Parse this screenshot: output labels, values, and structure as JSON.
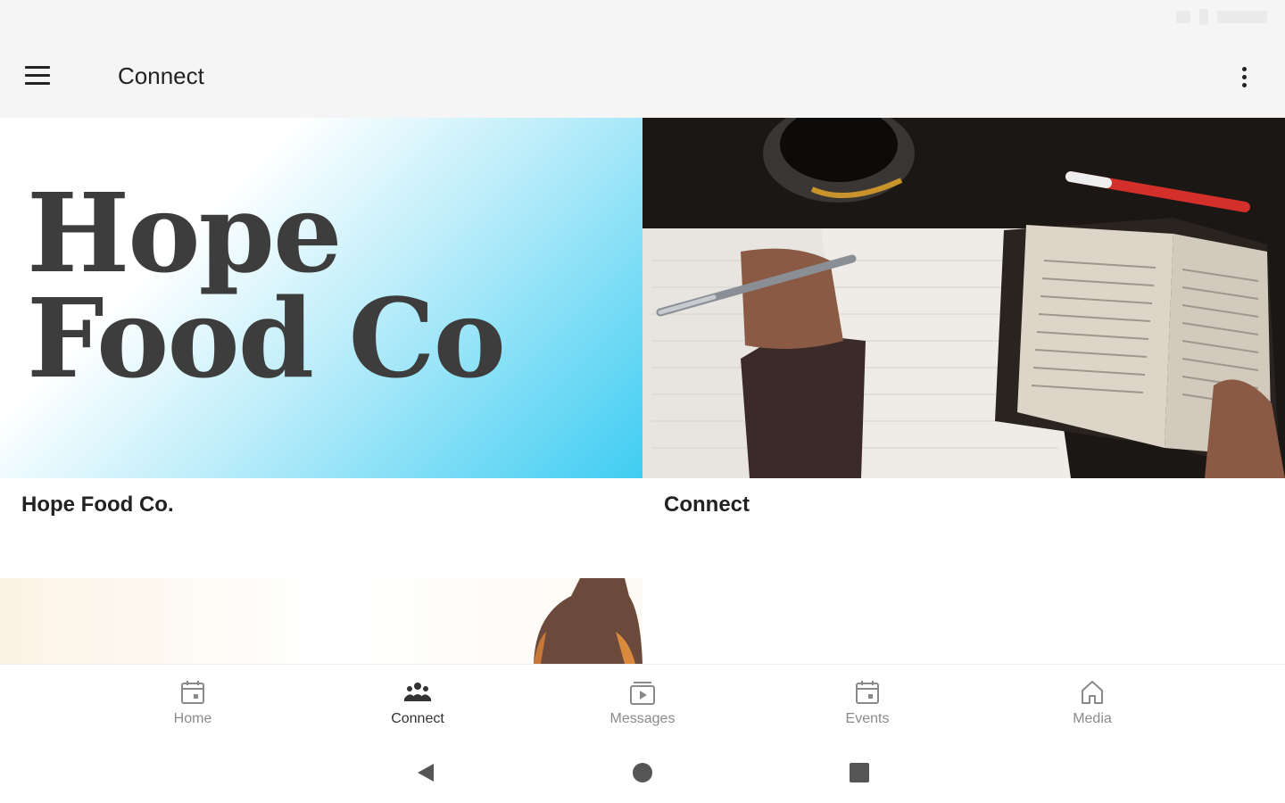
{
  "app_bar": {
    "title": "Connect"
  },
  "cards": [
    {
      "logo_line1": "Hope",
      "logo_line2": "Food Co",
      "caption": "Hope Food Co."
    },
    {
      "caption": "Connect"
    }
  ],
  "bottom_nav": {
    "items": [
      {
        "label": "Home",
        "icon": "calendar-icon"
      },
      {
        "label": "Connect",
        "icon": "group-icon",
        "active": true
      },
      {
        "label": "Messages",
        "icon": "video-icon"
      },
      {
        "label": "Events",
        "icon": "calendar-icon"
      },
      {
        "label": "Media",
        "icon": "house-icon"
      }
    ]
  },
  "colors": {
    "accent_gradient_end": "#3fcdf2",
    "nav_inactive": "#8a8a8a",
    "text_primary": "#222222"
  }
}
